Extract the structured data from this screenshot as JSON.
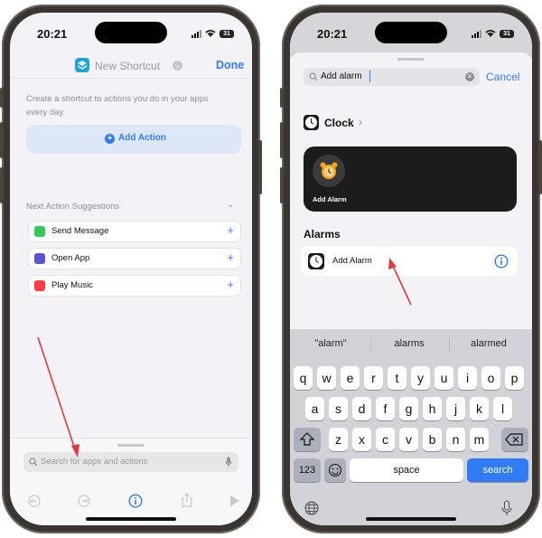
{
  "left": {
    "status_time": "20:21",
    "battery": "31",
    "header_title": "New Shortcut",
    "done_label": "Done",
    "intro_text": "Create a shortcut to actions you do in your apps every day.",
    "add_action_label": "Add Action",
    "suggestions_title": "Next Action Suggestions",
    "suggestions": [
      {
        "label": "Send Message",
        "color": "#34c759"
      },
      {
        "label": "Open App",
        "color": "#5856d6"
      },
      {
        "label": "Play Music",
        "color": "#fc3c44"
      }
    ],
    "search_placeholder": "Search for apps and actions"
  },
  "right": {
    "status_time": "20:21",
    "battery": "31",
    "search_value": "Add alarm",
    "cancel_label": "Cancel",
    "clock_label": "Clock",
    "card_label": "Add Alarm",
    "section_title": "Alarms",
    "alarm_item_label": "Add Alarm",
    "suggestions": [
      "\"alarm\"",
      "alarms",
      "alarmed"
    ],
    "keyboard": {
      "row1": [
        "q",
        "w",
        "e",
        "r",
        "t",
        "y",
        "u",
        "i",
        "o",
        "p"
      ],
      "row2": [
        "a",
        "s",
        "d",
        "f",
        "g",
        "h",
        "j",
        "k",
        "l"
      ],
      "row3": [
        "z",
        "x",
        "c",
        "v",
        "b",
        "n",
        "m"
      ],
      "num_label": "123",
      "space_label": "space",
      "search_label": "search"
    }
  },
  "colors": {
    "accent": "#2f7cf6",
    "arrow": "#e0393e",
    "keyboard_bg": "#d1d3d9"
  }
}
